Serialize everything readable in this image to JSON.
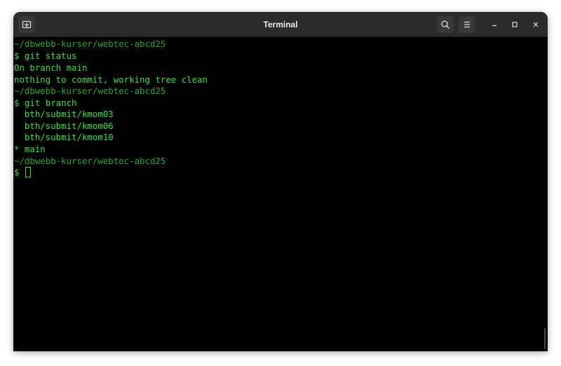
{
  "window": {
    "title": "Terminal"
  },
  "titlebar": {
    "new_tab_icon": "new-tab-icon",
    "search_icon": "search-icon",
    "menu_icon": "hamburger-menu-icon",
    "minimize_icon": "minimize-icon",
    "maximize_icon": "maximize-icon",
    "close_icon": "close-icon"
  },
  "terminal": {
    "colors": {
      "background": "#000000",
      "text": "#2fe03a",
      "prompt_path": "#1fa82a"
    },
    "lines": [
      "~/dbwebb-kurser/webtec-abcd25",
      "$ git status",
      "On branch main",
      "nothing to commit, working tree clean",
      "~/dbwebb-kurser/webtec-abcd25",
      "$ git branch",
      "  bth/submit/kmom03",
      "  bth/submit/kmom06",
      "  bth/submit/kmom10",
      "* main",
      "~/dbwebb-kurser/webtec-abcd25"
    ],
    "prompt": "$ "
  }
}
